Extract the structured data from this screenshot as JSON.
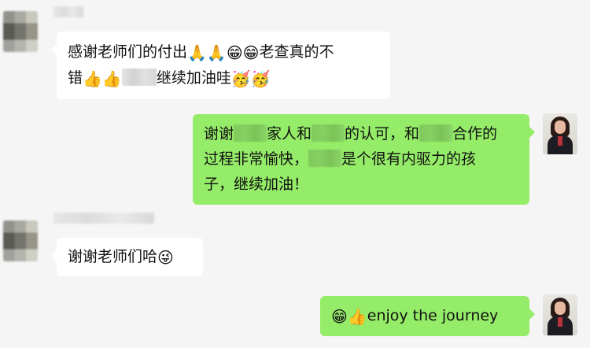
{
  "messages": [
    {
      "side": "left",
      "line1": "感谢老师们的付出",
      "emoji1": "🙏🙏😁😁",
      "line1b": "老查真的不",
      "line2a": "错",
      "emoji2": "👍👍",
      "line2b": "继续加油哇",
      "emoji3": "🥳🥳"
    },
    {
      "side": "right",
      "t1": "谢谢",
      "t2": "家人和",
      "t3": "的认可，和",
      "t4": "合作的",
      "t5": "过程非常愉快，",
      "t6": "是个很有内驱力的孩",
      "t7": "子，继续加油！"
    },
    {
      "side": "left",
      "text": "谢谢老师们哈",
      "emoji": "😜"
    },
    {
      "side": "right",
      "emoji": "😁👍",
      "text": "enjoy the journey"
    }
  ],
  "colors": {
    "background": "#f5f5f5",
    "outgoing_bubble": "#95ec69",
    "incoming_bubble": "#ffffff"
  }
}
